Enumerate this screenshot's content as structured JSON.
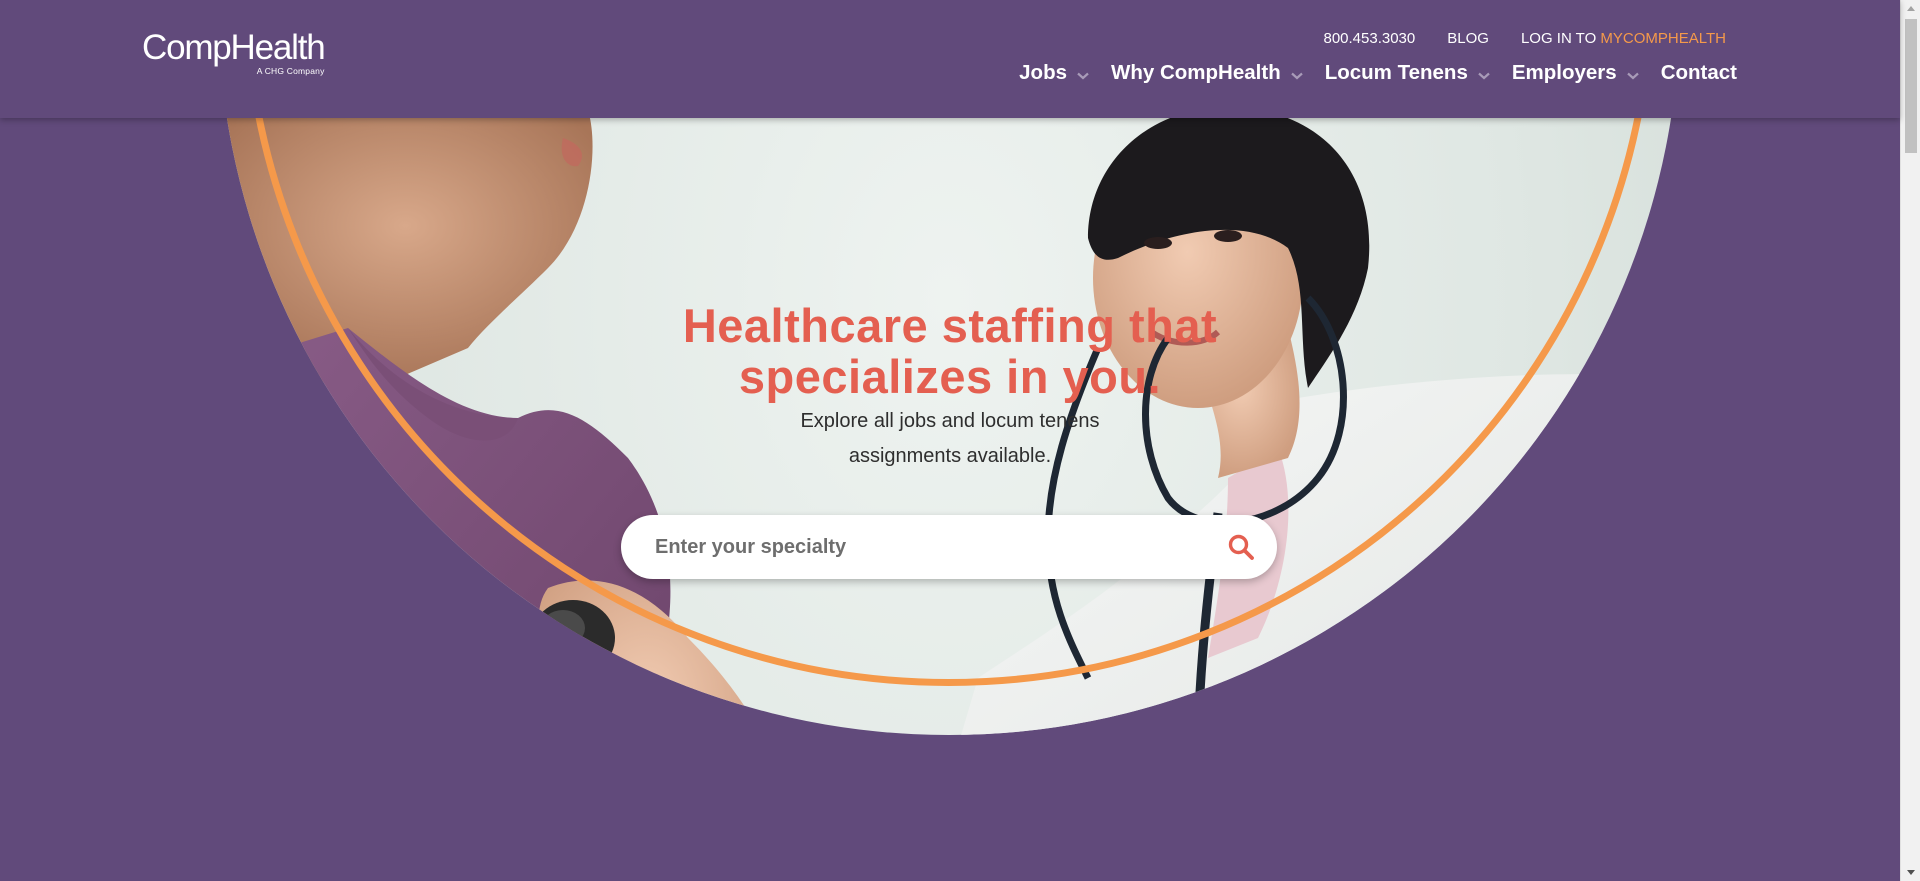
{
  "header": {
    "logo_name": "CompHealth",
    "logo_sub": "A CHG Company",
    "utility": {
      "phone": "800.453.3030",
      "blog": "BLOG",
      "login_prefix": "LOG IN TO",
      "login_accent": "MYCOMPHEALTH"
    },
    "nav": [
      {
        "label": "Jobs",
        "has_dropdown": true
      },
      {
        "label": "Why CompHealth",
        "has_dropdown": true
      },
      {
        "label": "Locum Tenens",
        "has_dropdown": true
      },
      {
        "label": "Employers",
        "has_dropdown": true
      },
      {
        "label": "Contact",
        "has_dropdown": false
      }
    ]
  },
  "hero": {
    "title_line1": "Healthcare staffing that",
    "title_line2": "specializes in you.",
    "subtitle_line1": "Explore all jobs and locum tenens",
    "subtitle_line2": "assignments available.",
    "search_placeholder": "Enter your specialty",
    "search_icon": "search-icon"
  },
  "colors": {
    "brand_purple": "#614a7b",
    "accent_orange": "#f5994a",
    "headline_coral": "#e45f50",
    "white": "#ffffff"
  }
}
